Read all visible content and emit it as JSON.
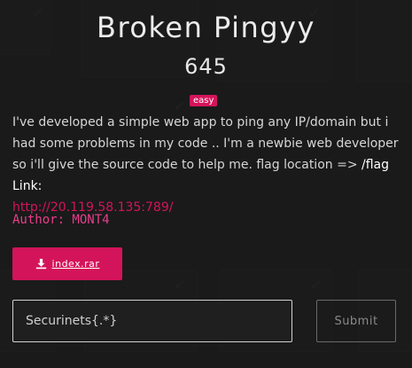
{
  "challenge": {
    "title": "Broken Pingyy",
    "points": "645",
    "difficulty": "easy",
    "description": "I've developed a simple web app to ping any IP/domain but i had some problems in my code .. I'm a newbie web developer so i'll give the source code to help me. flag location => ",
    "flag_location": "/flag Link:",
    "link": "http://20.119.58.135:789/",
    "author": "Author: MONT4",
    "attachment": "index.rar"
  },
  "form": {
    "flag_value": "Securinets{.*}",
    "submit_label": "Submit"
  },
  "icons": {
    "download": "download-icon",
    "check": "check-icon"
  },
  "colors": {
    "accent": "#d4145a",
    "background": "#1b1b1b"
  }
}
